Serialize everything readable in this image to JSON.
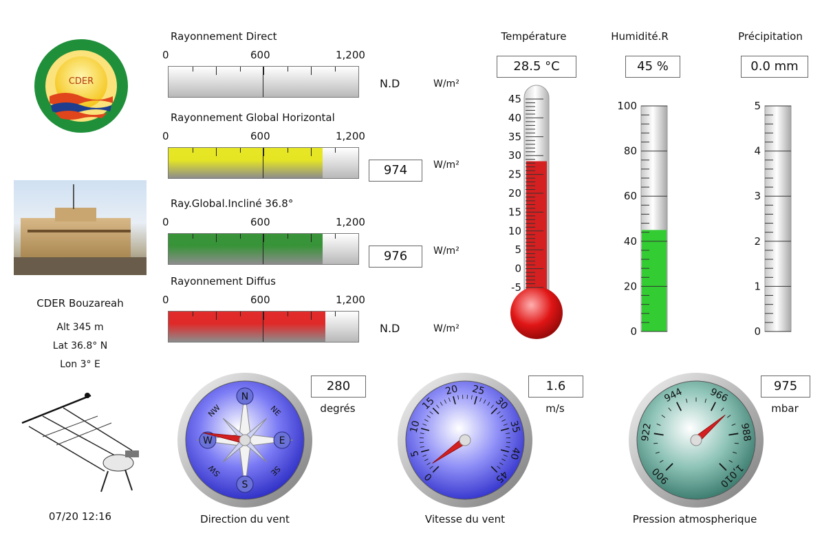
{
  "station": {
    "name": "CDER Bouzareah",
    "alt": "Alt 345 m",
    "lat": "Lat 36.8° N",
    "lon": "Lon 3° E",
    "datetime": "07/20 12:16",
    "logo_text": "CDER"
  },
  "radiation": {
    "unit": "W/m²",
    "scale_labels": [
      "0",
      "600",
      "1,200"
    ],
    "bars": [
      {
        "title": "Rayonnement Direct",
        "value": "N.D",
        "level": 0,
        "color": "#c8c8c8",
        "boxed": false
      },
      {
        "title": "Rayonnement Global Horizontal",
        "value": "974",
        "level": 974,
        "color": "#e5e51a",
        "boxed": true
      },
      {
        "title": "Ray.Global.Incliné 36.8°",
        "value": "976",
        "level": 976,
        "color": "#2f8f2f",
        "boxed": true
      },
      {
        "title": "Rayonnement Diffus",
        "value": "N.D",
        "level": 990,
        "color": "#e02020",
        "boxed": false
      }
    ]
  },
  "temperature": {
    "title": "Température",
    "value": "28.5 °C",
    "level": 28.5,
    "ticks": [
      "45",
      "40",
      "35",
      "30",
      "25",
      "20",
      "15",
      "10",
      "5",
      "0",
      "-5"
    ],
    "color": "#d42020"
  },
  "humidity": {
    "title": "Humidité.R",
    "value": "45 %",
    "level": 45,
    "ticks": [
      "100",
      "80",
      "60",
      "40",
      "20",
      "0"
    ],
    "color": "#33cc33"
  },
  "precipitation": {
    "title": "Précipitation",
    "value": "0.0 mm",
    "level": 0,
    "ticks": [
      "5",
      "4",
      "3",
      "2",
      "1",
      "0"
    ]
  },
  "wind_direction": {
    "title": "Direction du vent",
    "value": "280",
    "unit": "degrés",
    "level": 280,
    "cardinals": [
      "N",
      "E",
      "S",
      "W"
    ],
    "intercardinals": [
      "NE",
      "SE",
      "SW",
      "NW"
    ]
  },
  "wind_speed": {
    "title": "Vitesse du vent",
    "value": "1.6",
    "unit": "m/s",
    "level": 1.6,
    "scale_labels": [
      "0",
      "5",
      "10",
      "15",
      "20",
      "25",
      "30",
      "35",
      "40",
      "45"
    ]
  },
  "pressure": {
    "title": "Pression atmospherique",
    "value": "975",
    "unit": "mbar",
    "level": 975,
    "scale_labels": [
      "900",
      "922",
      "944",
      "966",
      "988",
      "1,010"
    ]
  }
}
